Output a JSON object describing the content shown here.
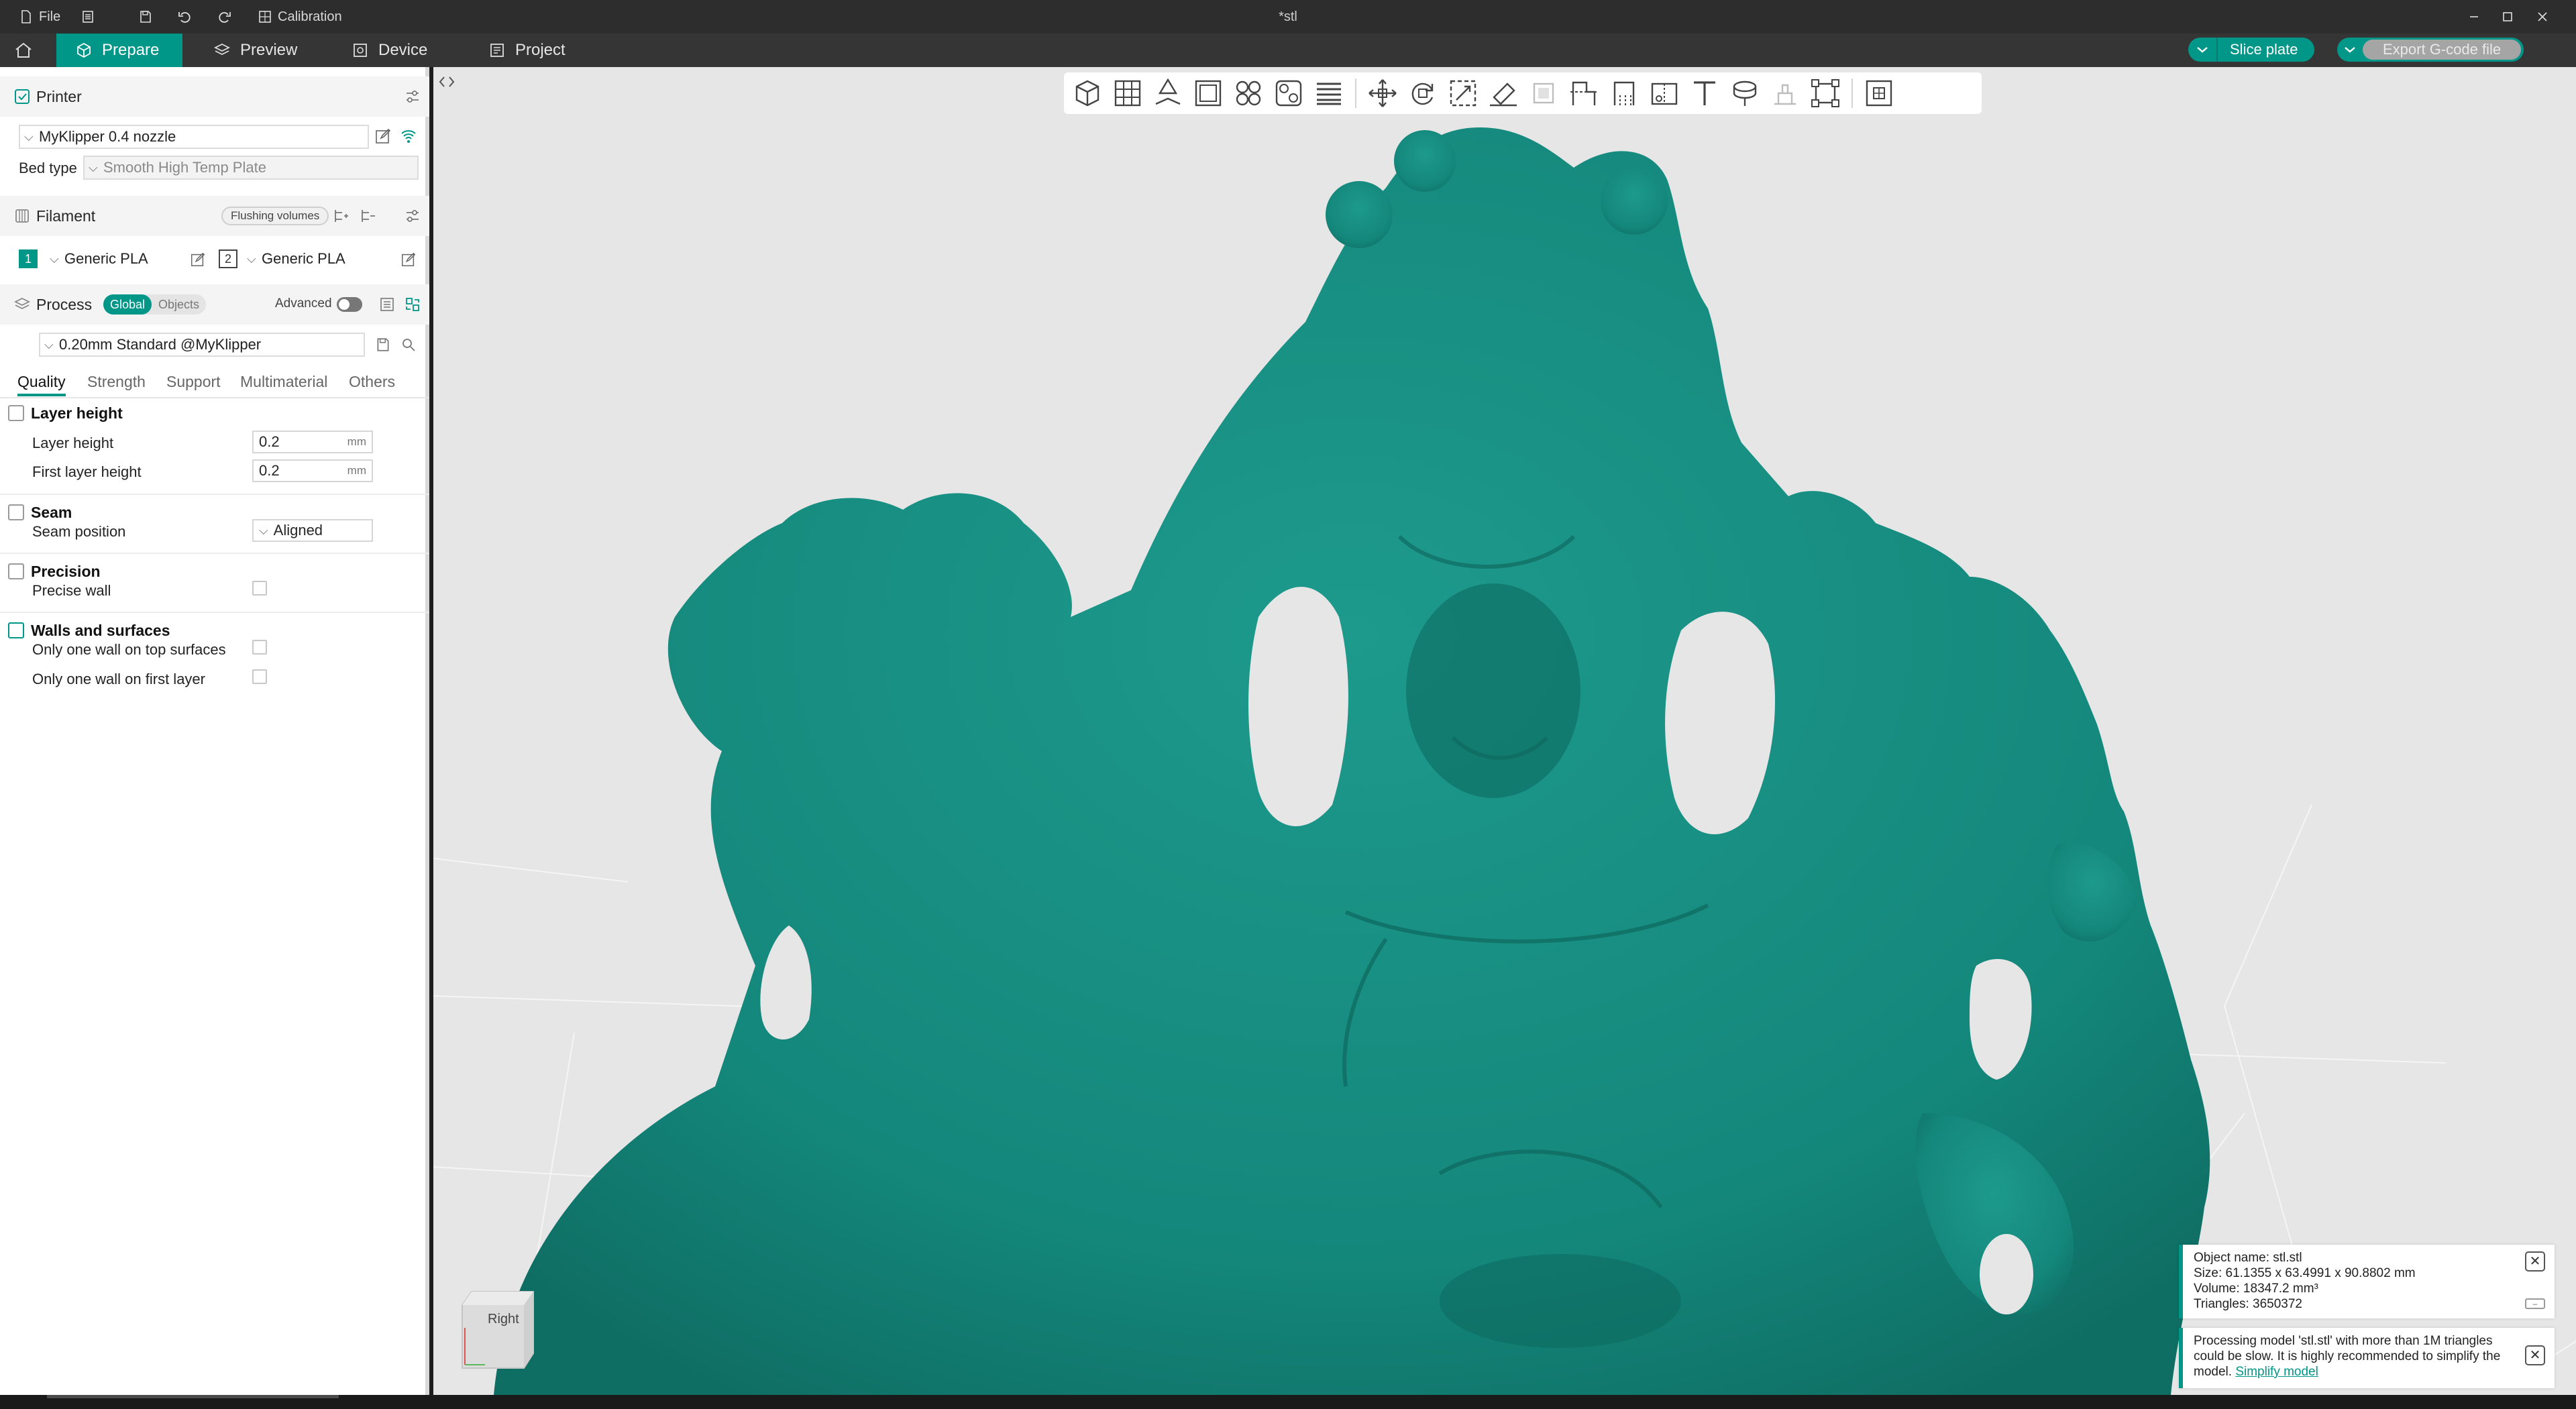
{
  "titlebar": {
    "file_label": "File",
    "calibration_label": "Calibration",
    "window_title": "*stl",
    "icons": [
      "file-icon",
      "menu-icon",
      "save-icon",
      "undo-icon",
      "redo-icon",
      "calibration-icon",
      "minimize-icon",
      "maximize-icon",
      "close-icon"
    ]
  },
  "navbar": {
    "tabs": [
      {
        "label": "Prepare",
        "active": true,
        "icon": "cube-icon"
      },
      {
        "label": "Preview",
        "active": false,
        "icon": "layers-icon"
      },
      {
        "label": "Device",
        "active": false,
        "icon": "device-icon"
      },
      {
        "label": "Project",
        "active": false,
        "icon": "project-icon"
      }
    ],
    "slice_label": "Slice plate",
    "export_label": "Export G-code file",
    "accent": "#009688"
  },
  "printer": {
    "title": "Printer",
    "name": "MyKlipper 0.4 nozzle",
    "bed_type_label": "Bed type",
    "bed_type": "Smooth High Temp Plate"
  },
  "filament": {
    "title": "Filament",
    "flushing_label": "Flushing volumes",
    "items": [
      {
        "num": "1",
        "name": "Generic PLA"
      },
      {
        "num": "2",
        "name": "Generic PLA"
      }
    ]
  },
  "process": {
    "title": "Process",
    "global_label": "Global",
    "objects_label": "Objects",
    "advanced_label": "Advanced",
    "advanced_on": false,
    "preset": "0.20mm Standard @MyKlipper",
    "tabs": [
      "Quality",
      "Strength",
      "Support",
      "Multimaterial",
      "Others"
    ],
    "active_tab": "Quality",
    "groups": {
      "layer_height": {
        "title": "Layer height",
        "layer_height_label": "Layer height",
        "layer_height_value": "0.2",
        "first_layer_label": "First layer height",
        "first_layer_value": "0.2",
        "unit": "mm"
      },
      "seam": {
        "title": "Seam",
        "position_label": "Seam position",
        "position_value": "Aligned"
      },
      "precision": {
        "title": "Precision",
        "precise_wall_label": "Precise wall",
        "precise_wall": false
      },
      "walls": {
        "title": "Walls and surfaces",
        "top_label": "Only one wall on top surfaces",
        "top": false,
        "first_label": "Only one wall on first layer",
        "first": false
      }
    }
  },
  "viewport": {
    "toolbar_icons": [
      "add-object-icon",
      "add-plate-icon",
      "auto-orient-icon",
      "arrange-plate-icon",
      "split-objects-icon",
      "split-parts-icon",
      "variable-layer-height-icon",
      "move-icon",
      "rotate-icon",
      "scale-icon",
      "lay-on-face-icon",
      "fuzzy-skin-icon",
      "cut-icon",
      "support-paint-icon",
      "seam-paint-icon",
      "text-icon",
      "measure-icon",
      "assembly-icon",
      "mesh-boolean-icon",
      "brim-ears-icon"
    ],
    "navcube_face": "Right",
    "model_color": "#14877b",
    "background": "#e6e6e6"
  },
  "notifications": {
    "object_info": {
      "name_line": "Object name: stl.stl",
      "size_line": "Size: 61.1355 x 63.4991 x 90.8802 mm",
      "volume_line": "Volume: 18347.2 mm³",
      "triangles_line": "Triangles: 3650372"
    },
    "warning": {
      "text": "Processing model 'stl.stl' with more than 1M triangles could be slow. It is highly recommended to simplify the model.",
      "link": "Simplify model"
    }
  }
}
